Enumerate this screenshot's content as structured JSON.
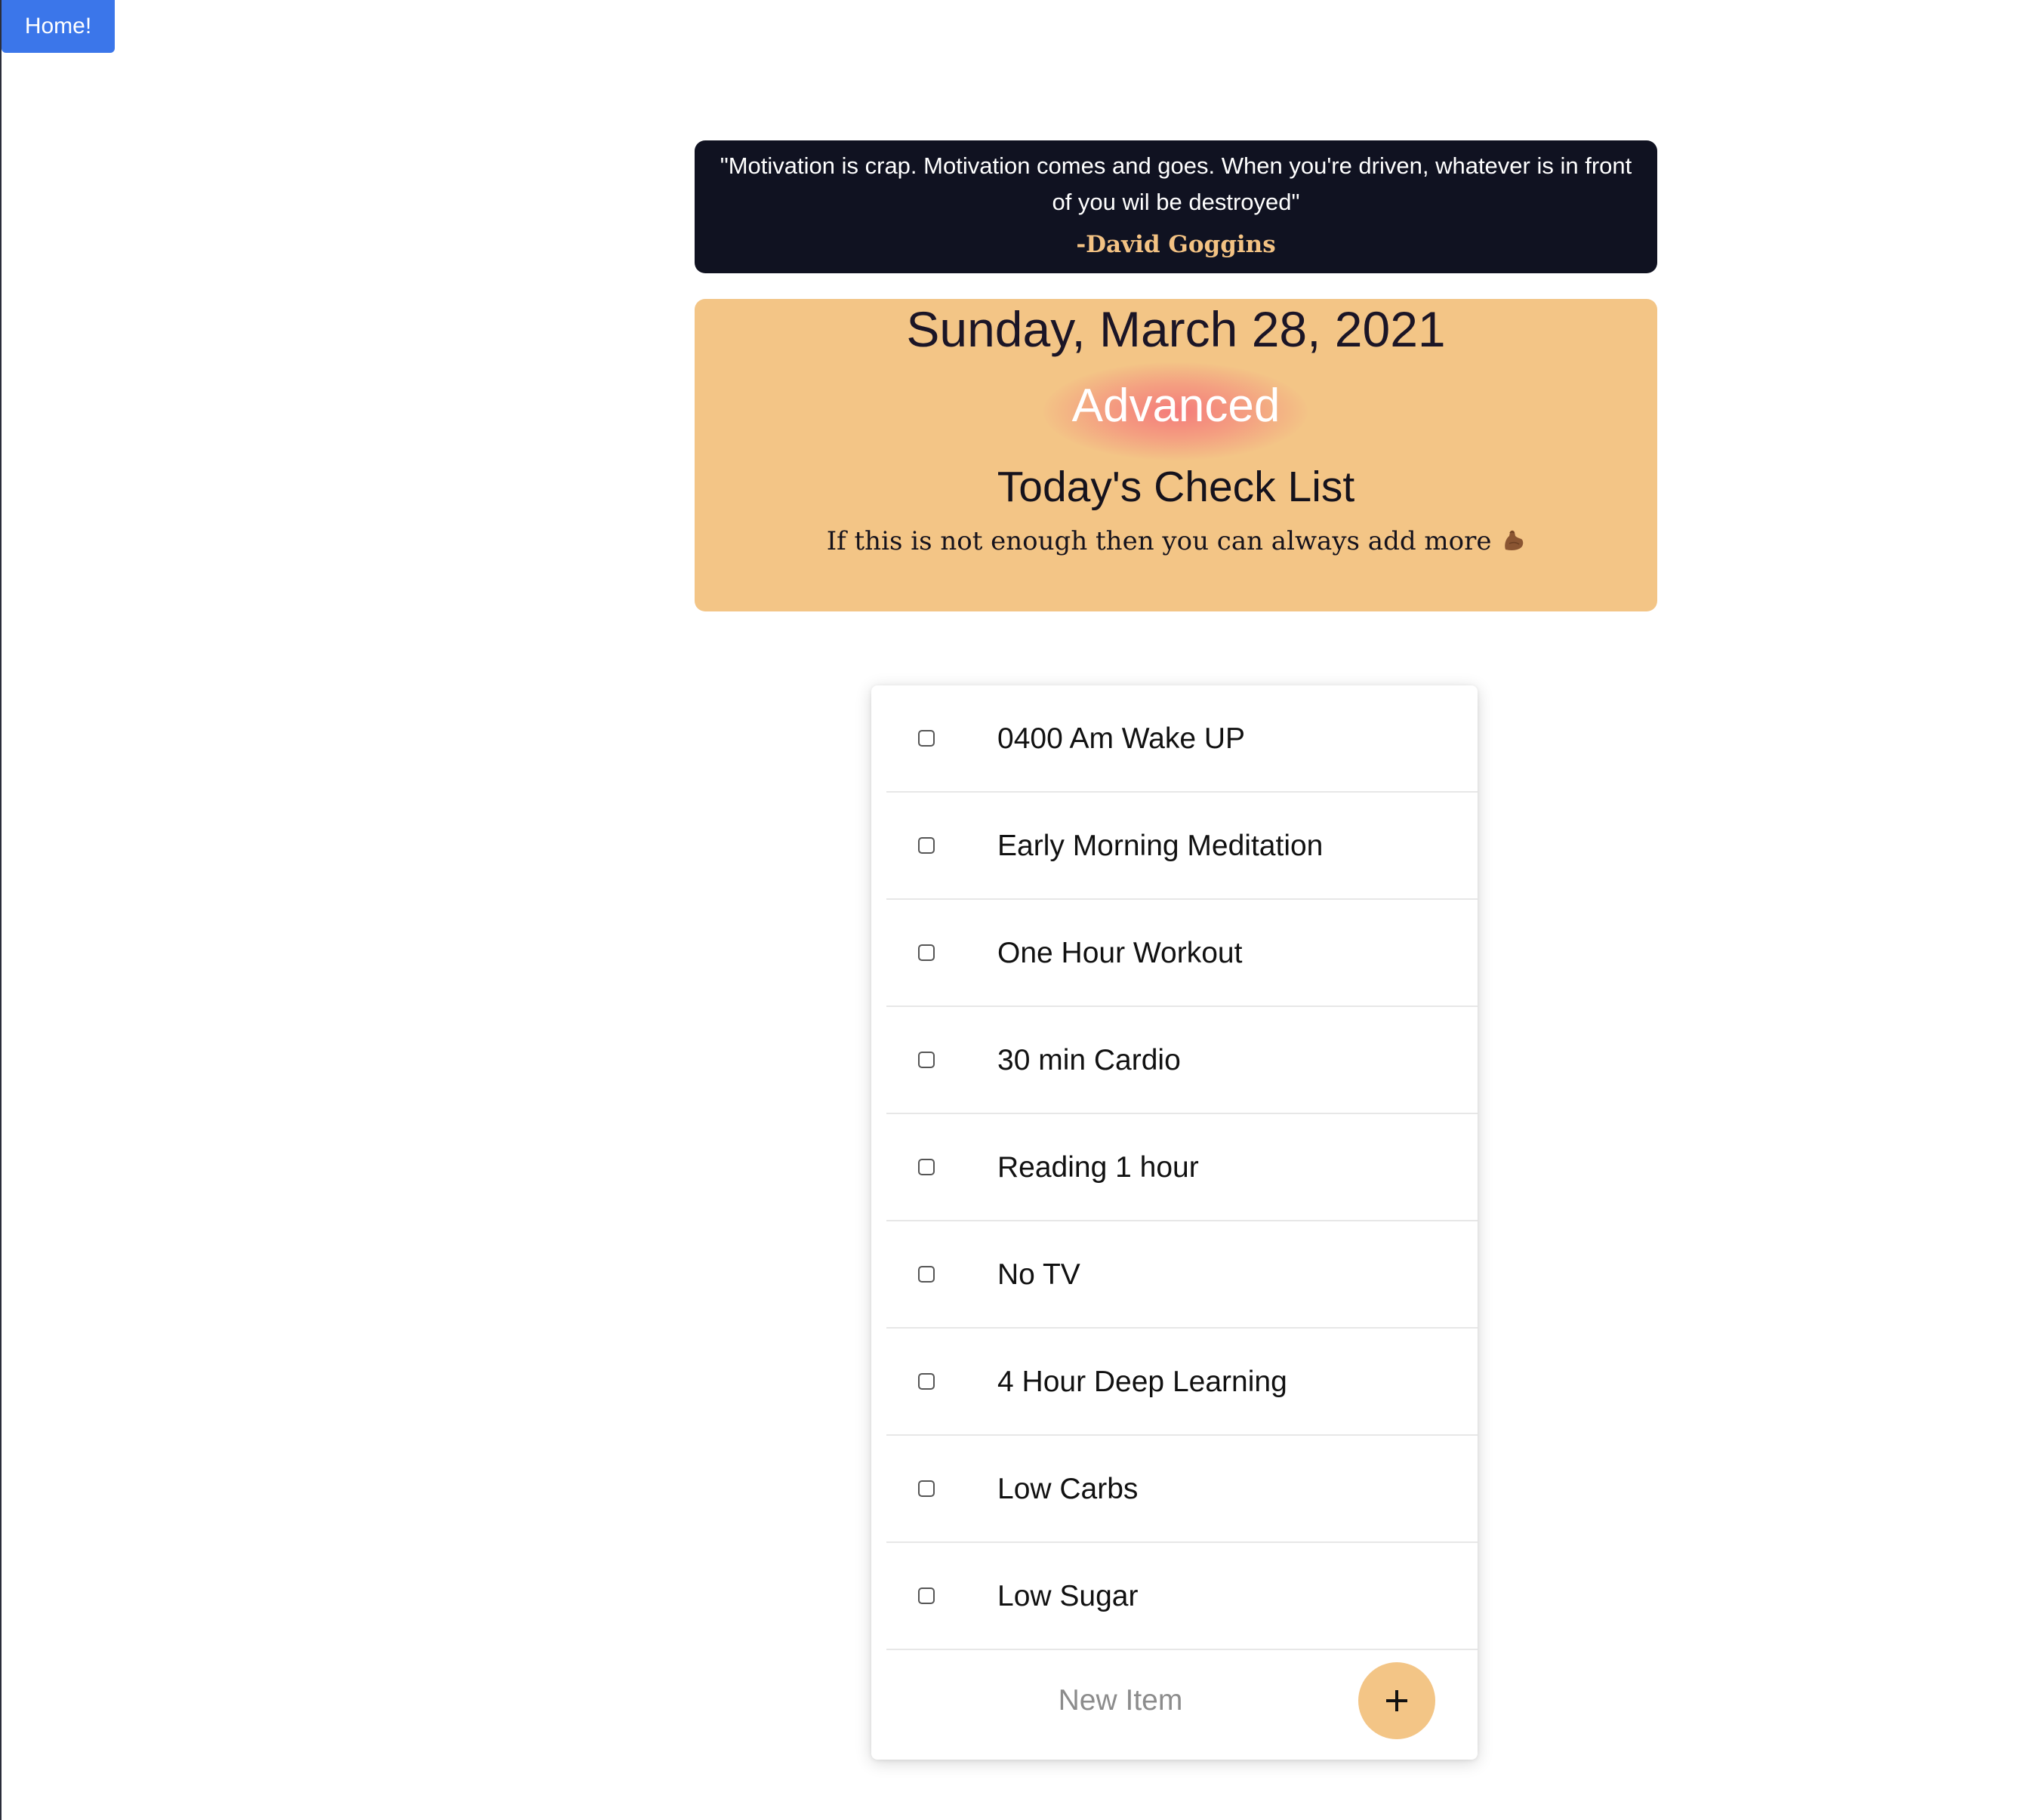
{
  "nav": {
    "home_label": "Home!"
  },
  "quote": {
    "text": "\"Motivation is crap. Motivation comes and goes. When you're driven, whatever is in front of you wil be destroyed\"",
    "author": "-David Goggins"
  },
  "day": {
    "date": "Sunday, March 28, 2021",
    "level": "Advanced",
    "checklist_title": "Today's Check List",
    "encouragement": "If this is not enough then you can always add more",
    "encouragement_icon": "flexed-biceps-icon"
  },
  "checklist": {
    "items": [
      {
        "label": "0400 Am Wake UP",
        "checked": false
      },
      {
        "label": "Early Morning Meditation",
        "checked": false
      },
      {
        "label": "One Hour Workout",
        "checked": false
      },
      {
        "label": "30 min Cardio",
        "checked": false
      },
      {
        "label": "Reading 1 hour",
        "checked": false
      },
      {
        "label": "No TV",
        "checked": false
      },
      {
        "label": "4 Hour Deep Learning",
        "checked": false
      },
      {
        "label": "Low Carbs",
        "checked": false
      },
      {
        "label": "Low Sugar",
        "checked": false
      }
    ],
    "new_item_placeholder": "New Item",
    "add_icon": "plus-icon"
  },
  "colors": {
    "home_button": "#3b76ea",
    "quote_background": "#101221",
    "quote_author": "#f3c283",
    "day_background": "#f3c586",
    "level_glow": "#f46e78",
    "add_button": "#f3c586"
  }
}
